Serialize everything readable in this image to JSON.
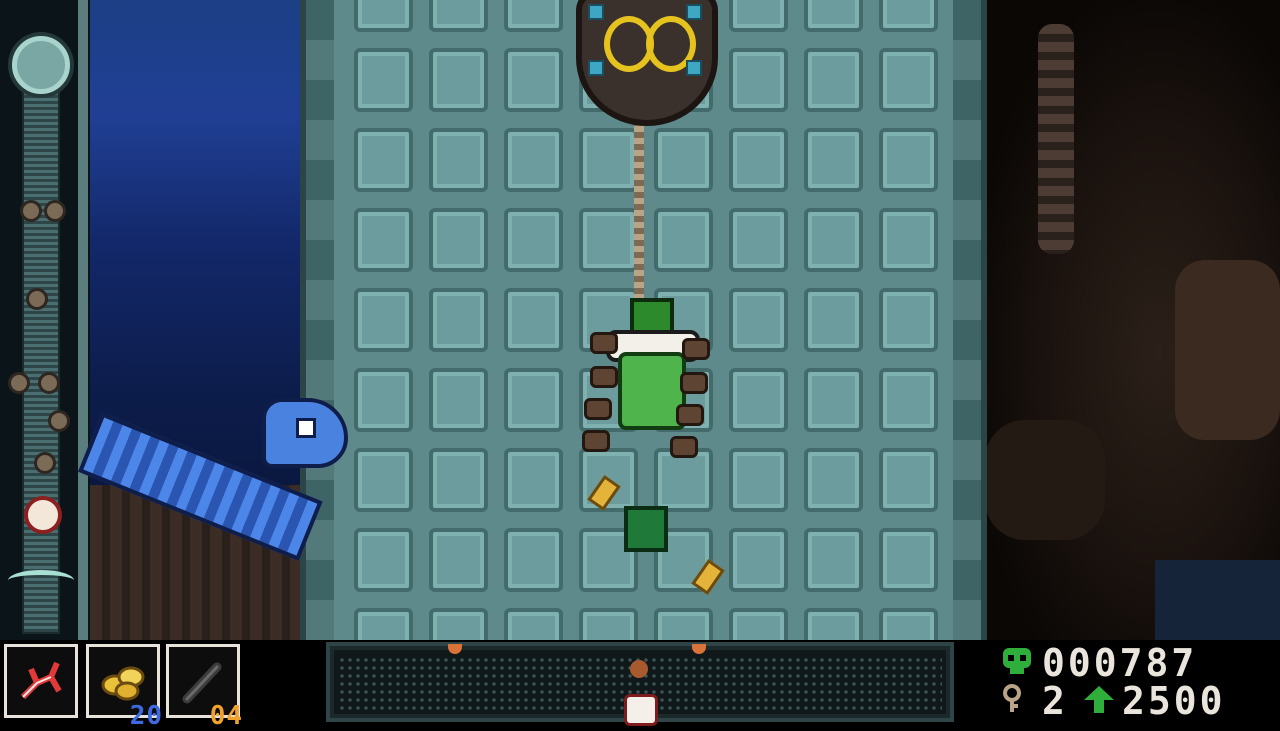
{
  "hud": {
    "slots": [
      {
        "name": "relic",
        "icon": "red-branch-relic-icon",
        "count": ""
      },
      {
        "name": "gold",
        "icon": "gold-pile-icon",
        "count": "20",
        "count_color": "#3f69e0"
      },
      {
        "name": "bomb",
        "icon": "bomb-stick-icon",
        "count": "04",
        "count_color": "#f0a22a"
      }
    ],
    "score": {
      "icon": "green-skull-icon",
      "value": "000787"
    },
    "keys": {
      "icon": "key-icon",
      "value": "2"
    },
    "next_level": {
      "icon": "green-arrow-up-icon",
      "value": "2500"
    }
  },
  "colors": {
    "tower": "#5f8a8c",
    "score_digits": "#9aa6a6",
    "score_value": "#e9e5dc",
    "accent_green": "#2fae3c",
    "depth_blue": "#203f94"
  }
}
